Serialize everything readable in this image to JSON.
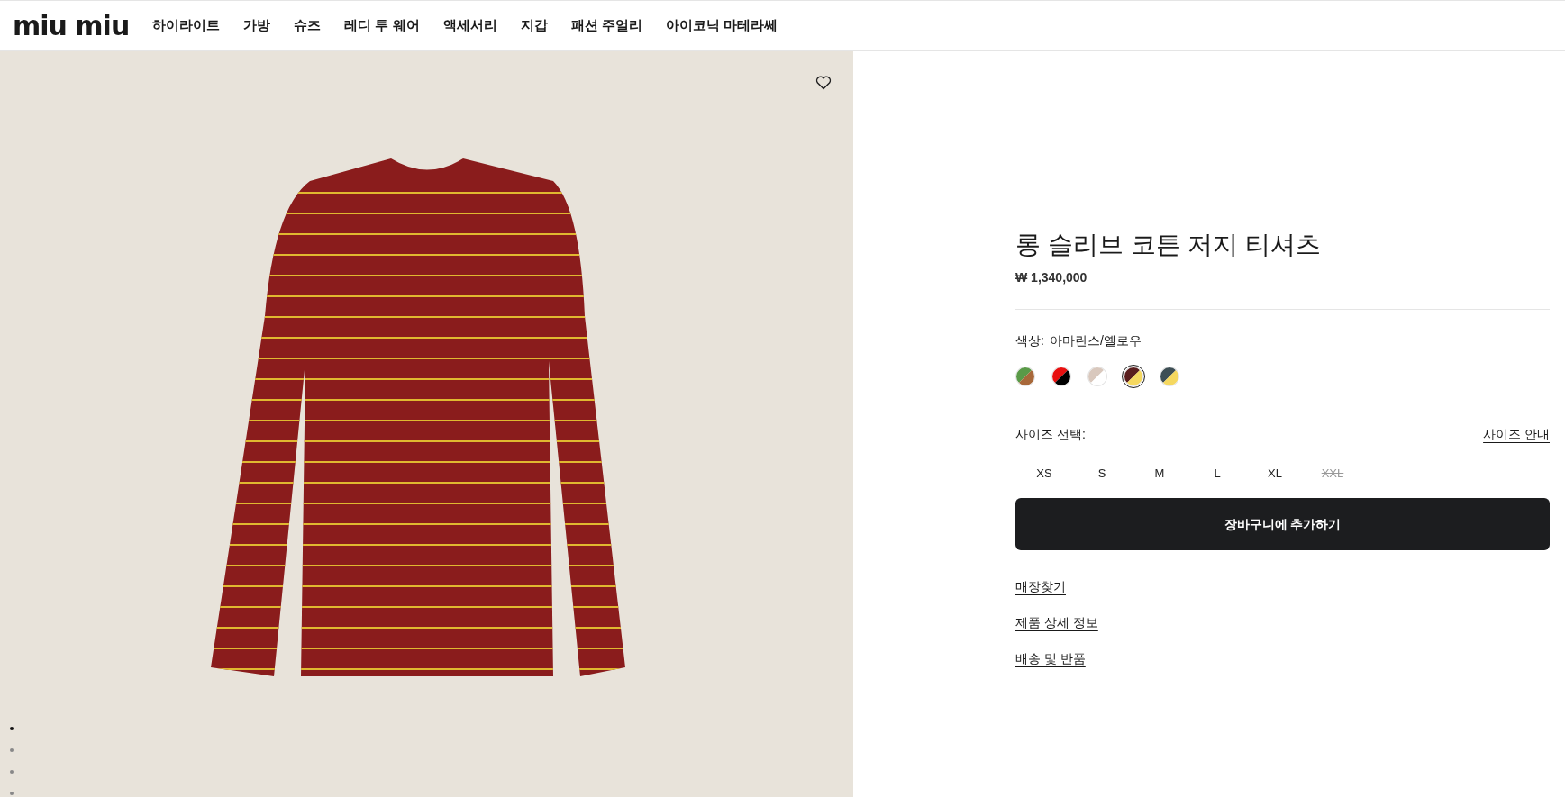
{
  "header": {
    "logo": "miu miu",
    "nav": [
      "하이라이트",
      "가방",
      "슈즈",
      "레디 투 웨어",
      "액세서리",
      "지갑",
      "패션 주얼리",
      "아이코닉 마테라쎄"
    ]
  },
  "gallery": {
    "dots": [
      {
        "selected": true
      },
      {
        "selected": false
      },
      {
        "selected": false
      },
      {
        "selected": false
      }
    ]
  },
  "product": {
    "title": "롱 슬리브 코튼 저지 티셔츠",
    "price": "₩ 1,340,000",
    "color_label": "색상:",
    "color_value": "아마란스/옐로우",
    "swatches": [
      {
        "colors": [
          {
            "color": "#5a9a48"
          },
          {
            "color": "#a8683a"
          }
        ],
        "selected": false
      },
      {
        "colors": [
          {
            "color": "#e81010"
          },
          {
            "color": "#000000"
          }
        ],
        "selected": false
      },
      {
        "colors": [
          {
            "color": "#d9c8bd"
          },
          {
            "color": "#ffffff"
          }
        ],
        "selected": false
      },
      {
        "colors": [
          {
            "color": "#5a1e1e"
          },
          {
            "color": "#f5d860"
          }
        ],
        "selected": true
      },
      {
        "colors": [
          {
            "color": "#3e4f55"
          },
          {
            "color": "#f5d860"
          }
        ],
        "selected": false
      }
    ],
    "size_label": "사이즈 선택:",
    "size_guide": "사이즈 안내",
    "sizes": [
      {
        "label": "XS",
        "disabled": false
      },
      {
        "label": "S",
        "disabled": false
      },
      {
        "label": "M",
        "disabled": false
      },
      {
        "label": "L",
        "disabled": false
      },
      {
        "label": "XL",
        "disabled": false
      },
      {
        "label": "XXL",
        "disabled": true
      }
    ],
    "add_to_cart": "장바구니에 추가하기",
    "links": [
      "매장찾기",
      "제품 상세 정보",
      "배송 및 반품"
    ]
  }
}
